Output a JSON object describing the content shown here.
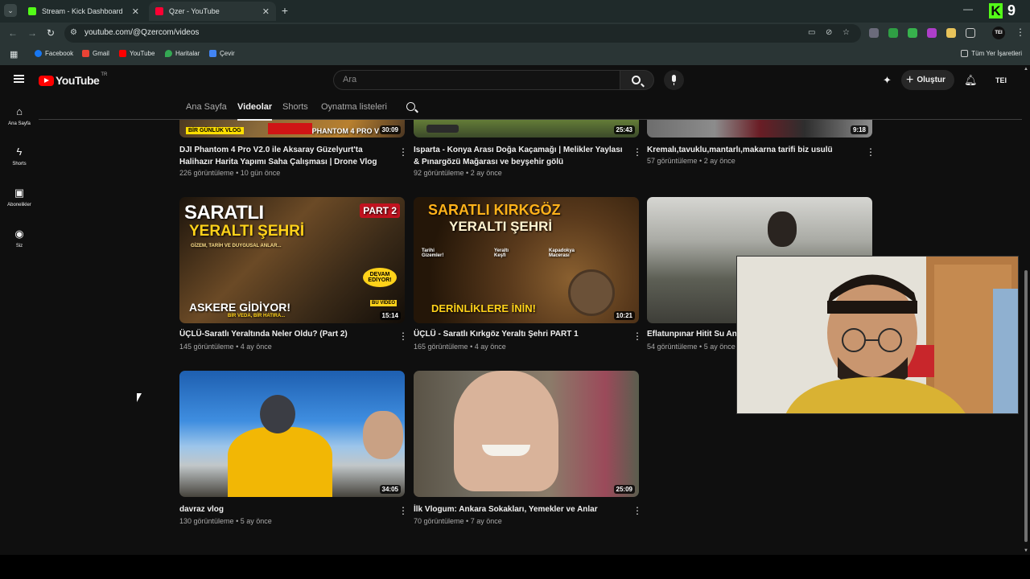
{
  "browser": {
    "tabs": [
      {
        "title": "Stream - Kick Dashboard",
        "favicon": "kick-icon",
        "active": false
      },
      {
        "title": "Qzer - YouTube",
        "favicon": "youtube-icon",
        "active": true
      }
    ],
    "url": "youtube.com/@Qzercom/videos",
    "profile_initials": "TEI",
    "bookmarks": [
      "Facebook",
      "Gmail",
      "YouTube",
      "Haritalar",
      "Çevir"
    ],
    "all_bookmarks": "Tüm Yer İşaretleri",
    "overlay_badge_letter": "K",
    "overlay_badge_number": "9",
    "colors": {
      "kick_green": "#53fc18",
      "youtube_red": "#ff0000"
    }
  },
  "youtube": {
    "logo_text": "YouTube",
    "country_code": "TR",
    "search_placeholder": "Ara",
    "create_label": "Oluştur",
    "avatar_initials": "TEI",
    "guide": [
      {
        "label": "Ana Sayfa",
        "icon": "home-icon"
      },
      {
        "label": "Shorts",
        "icon": "shorts-icon"
      },
      {
        "label": "Abonelikler",
        "icon": "subscriptions-icon"
      },
      {
        "label": "Siz",
        "icon": "you-icon"
      }
    ],
    "channel_tabs": [
      "Ana Sayfa",
      "Videolar",
      "Shorts",
      "Oynatma listeleri"
    ],
    "active_tab": "Videolar",
    "videos": [
      {
        "title": "DJI Phantom 4 Pro V2.0 ile Aksaray Güzelyurt'ta Halihazır Harita Yapımı Saha Çalışması  | Drone Vlog",
        "views": "226 görüntüleme",
        "age": "10 gün önce",
        "duration": "30:09",
        "thumb_overlay": [
          "BİR GÜNLÜK VLOG",
          "PHANTOM 4 PRO V"
        ]
      },
      {
        "title": "Isparta - Konya Arası Doğa Kaçamağı | Melikler Yaylası & Pınargözü Mağarası  ve beyşehir gölü",
        "views": "92 görüntüleme",
        "age": "2 ay önce",
        "duration": "25:43"
      },
      {
        "title": "Kremalı,tavuklu,mantarlı,makarna tarifi biz usulü",
        "views": "57 görüntüleme",
        "age": "2 ay önce",
        "duration": "9:18"
      },
      {
        "title": "ÜÇLÜ-Saratlı Yeraltında Neler Oldu? (Part 2)",
        "views": "145 görüntüleme",
        "age": "4 ay önce",
        "duration": "15:14",
        "thumb_overlay": [
          "SARATLI",
          "YERALTI ŞEHRİ",
          "PART 2",
          "GİZEM, TARİH VE DUYGUSAL ANLAR...",
          "DEVAM EDİYOR!",
          "ASKERE GİDİYOR!",
          "BİR VEDA, BİR HATIRA...",
          "BU VİDEO"
        ]
      },
      {
        "title": "ÜÇLÜ - Saratlı Kırkgöz Yeraltı Şehri  PART 1",
        "views": "165 görüntüleme",
        "age": "4 ay önce",
        "duration": "10:21",
        "thumb_overlay": [
          "SARATLI KIRKGÖZ",
          "YERALTI ŞEHRİ",
          "Tarihi Gizemler!",
          "Yeraltı Keşfi",
          "Kapadokya Macerası",
          "DERİNLİKLERE İNİN!"
        ]
      },
      {
        "title": "Eflatunpınar Hitit Su An",
        "views": "54 görüntüleme",
        "age": "5 ay önce",
        "duration": ""
      },
      {
        "title": "davraz vlog",
        "views": "130 görüntüleme",
        "age": "5 ay önce",
        "duration": "34:05"
      },
      {
        "title": "İlk Vlogum: Ankara Sokakları, Yemekler ve Anlar",
        "views": "70 görüntüleme",
        "age": "7 ay önce",
        "duration": "25:09"
      }
    ]
  }
}
